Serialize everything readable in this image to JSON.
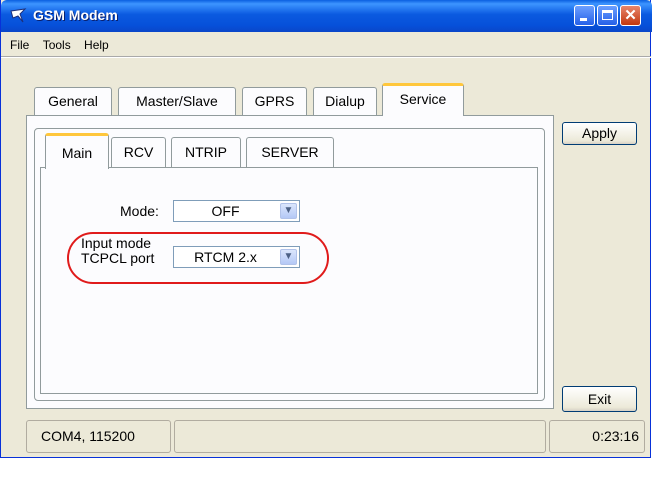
{
  "window": {
    "title": "GSM Modem",
    "app_icon": "antenna-icon"
  },
  "titlebar_buttons": {
    "minimize": "minimize-icon",
    "maximize": "maximize-icon",
    "close_glyph": "✕"
  },
  "menu": {
    "items": [
      "File",
      "Tools",
      "Help"
    ]
  },
  "outer_tabs": {
    "items": [
      "General",
      "Master/Slave",
      "GPRS",
      "Dialup",
      "Service"
    ],
    "active": "Service"
  },
  "inner_tabs": {
    "items": [
      "Main",
      "RCV",
      "NTRIP",
      "SERVER"
    ],
    "active": "Main"
  },
  "form": {
    "mode_label": "Mode:",
    "mode_value": "OFF",
    "input_mode_label_line1": "Input mode",
    "input_mode_label_line2": "TCPCL port",
    "input_mode_value": "RTCM 2.x"
  },
  "buttons": {
    "apply": "Apply",
    "exit": "Exit"
  },
  "status": {
    "port": "COM4, 115200",
    "middle": "",
    "time": "0:23:16"
  },
  "colors": {
    "titlebar": "#0a5fe0",
    "highlight": "#e01b1b",
    "active_tab_accent": "#ffc73c"
  }
}
